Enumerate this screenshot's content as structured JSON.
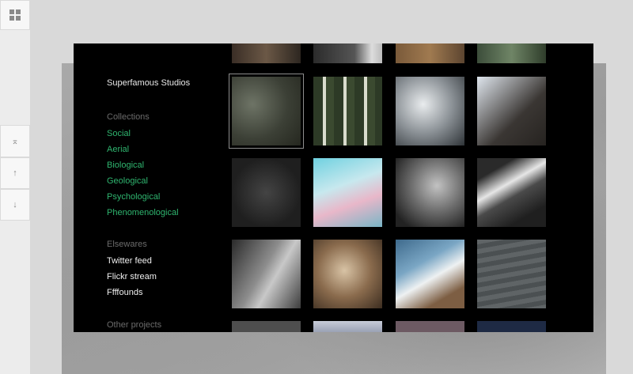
{
  "site_title": "Superfamous Studios",
  "collections": {
    "heading": "Collections",
    "items": [
      "Social",
      "Aerial",
      "Biological",
      "Geological",
      "Psychological",
      "Phenomenological"
    ]
  },
  "elsewares": {
    "heading": "Elsewares",
    "items": [
      "Twitter feed",
      "Flickr stream",
      "Ffffounds"
    ]
  },
  "other_projects": {
    "heading": "Other projects"
  },
  "controls": {
    "icons": [
      "grid-icon",
      "scroll-top-icon",
      "scroll-up-icon",
      "scroll-down-icon"
    ],
    "top_glyph": "⌅",
    "up_glyph": "↑",
    "down_glyph": "↓"
  },
  "colors": {
    "panel": "#000000",
    "link_green": "#2fb56f",
    "link_white": "#f0f0f0",
    "heading_gray": "#6b6b6b"
  }
}
